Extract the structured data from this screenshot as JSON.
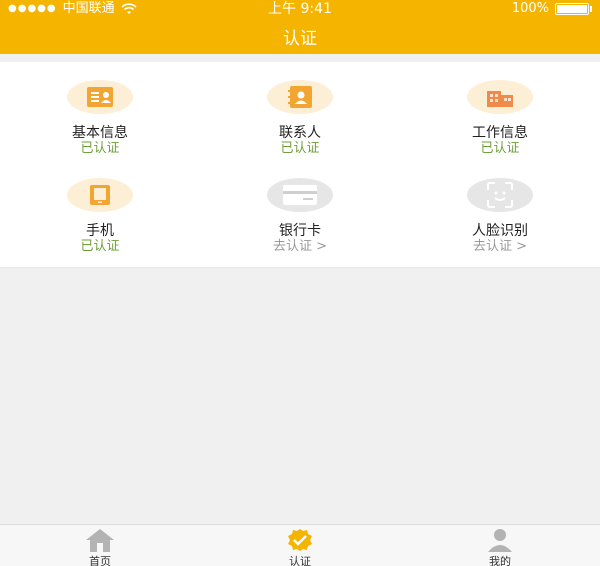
{
  "status_bar": {
    "carrier": "中国联通",
    "time": "上午 9:41",
    "battery": "100%"
  },
  "header": {
    "title": "认证"
  },
  "items": [
    {
      "name": "基本信息",
      "status": "已认证",
      "icon": "id-card-icon",
      "verified": true
    },
    {
      "name": "联系人",
      "status": "已认证",
      "icon": "contacts-book-icon",
      "verified": true
    },
    {
      "name": "工作信息",
      "status": "已认证",
      "icon": "building-icon",
      "verified": true
    },
    {
      "name": "手机",
      "status": "已认证",
      "icon": "phone-icon",
      "verified": true
    },
    {
      "name": "银行卡",
      "status": "去认证 >",
      "icon": "bank-card-icon",
      "verified": false
    },
    {
      "name": "人脸识别",
      "status": "去认证 >",
      "icon": "face-scan-icon",
      "verified": false
    }
  ],
  "tabbar": {
    "tabs": [
      {
        "label": "首页",
        "icon": "home-icon"
      },
      {
        "label": "认证",
        "icon": "verify-badge-icon",
        "active": true
      },
      {
        "label": "我的",
        "icon": "user-icon"
      }
    ]
  },
  "colors": {
    "brand": "#f5b400",
    "icon_orange": "#f2a530",
    "icon_orange_bg": "#fdeed6",
    "icon_grey_bg": "#e6e6e6",
    "verified_text": "#6f9e3b",
    "todo_text": "#999999"
  }
}
